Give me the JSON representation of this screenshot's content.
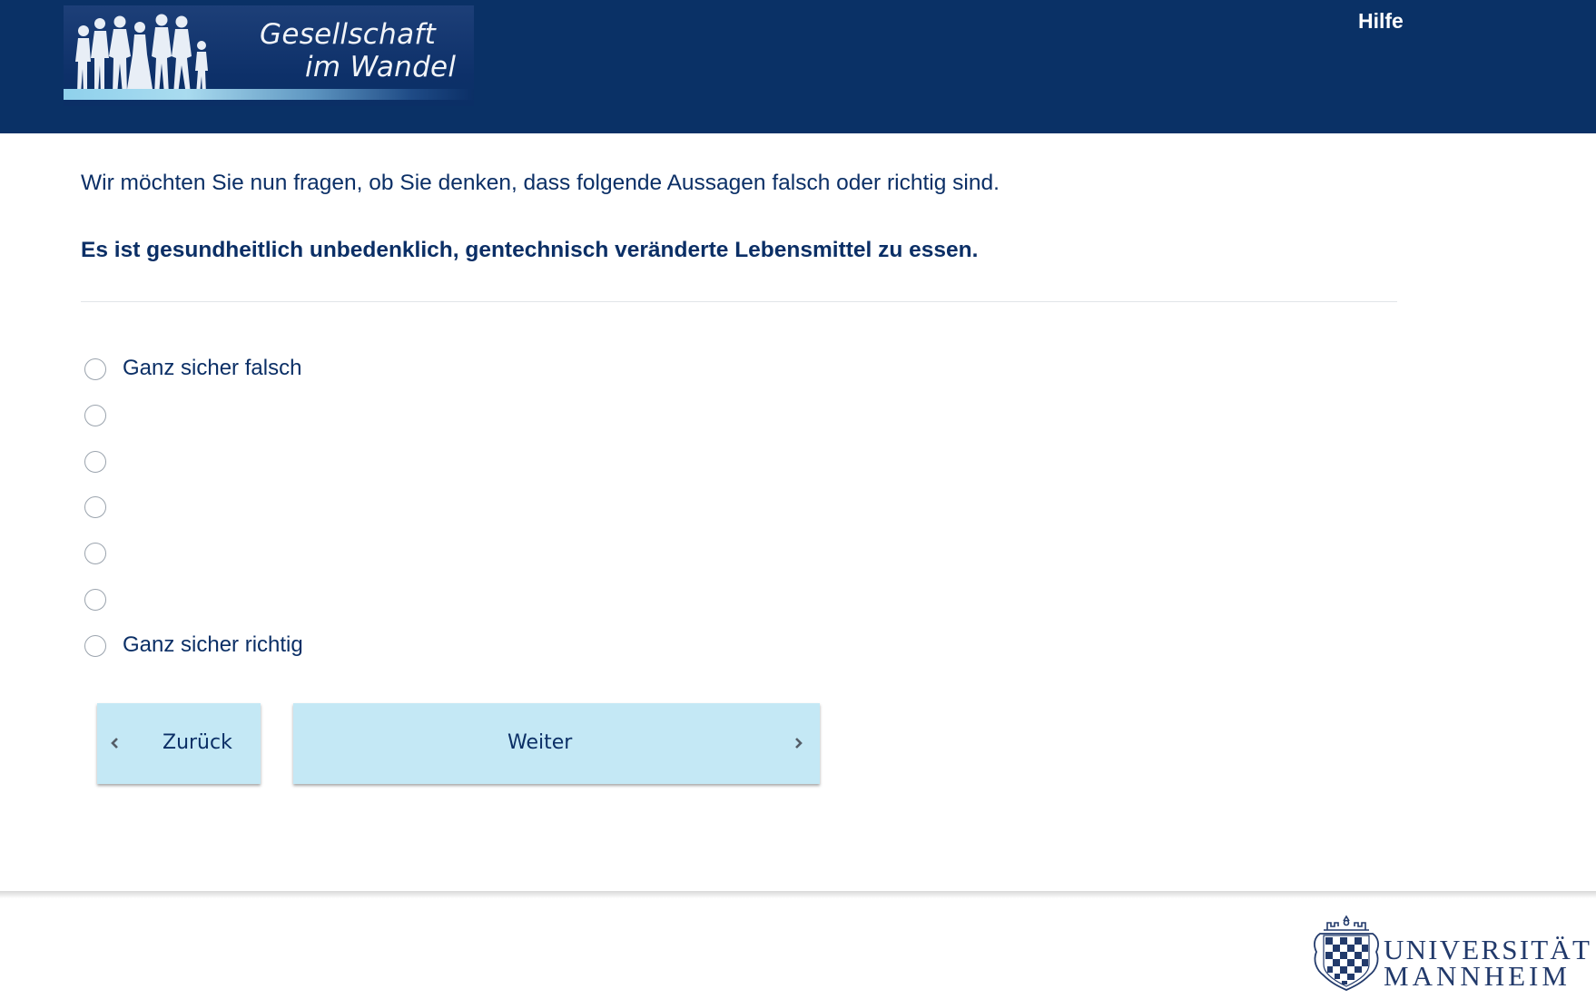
{
  "header": {
    "logo": {
      "line1": "Gesellschaft",
      "line2": "im Wandel"
    },
    "help_label": "Hilfe",
    "background_color": "#0a3166"
  },
  "main": {
    "intro": "Wir möchten Sie nun fragen, ob Sie denken, dass folgende Aussagen falsch oder richtig sind.",
    "question": "Es ist gesundheitlich unbedenklich, gentechnisch veränderte Lebensmittel zu essen.",
    "options": [
      {
        "label": "Ganz sicher falsch",
        "selected": false
      },
      {
        "label": "",
        "selected": false
      },
      {
        "label": "",
        "selected": false
      },
      {
        "label": "",
        "selected": false
      },
      {
        "label": "",
        "selected": false
      },
      {
        "label": "",
        "selected": false
      },
      {
        "label": "Ganz sicher richtig",
        "selected": false
      }
    ]
  },
  "navigation": {
    "back_label": "Zurück",
    "next_label": "Weiter",
    "button_color": "#c4e8f5"
  },
  "footer": {
    "university_line1": "UNIVERSITÄT",
    "university_line2": "MANNHEIM"
  },
  "colors": {
    "text": "#0b2f66",
    "header": "#0a3166"
  }
}
